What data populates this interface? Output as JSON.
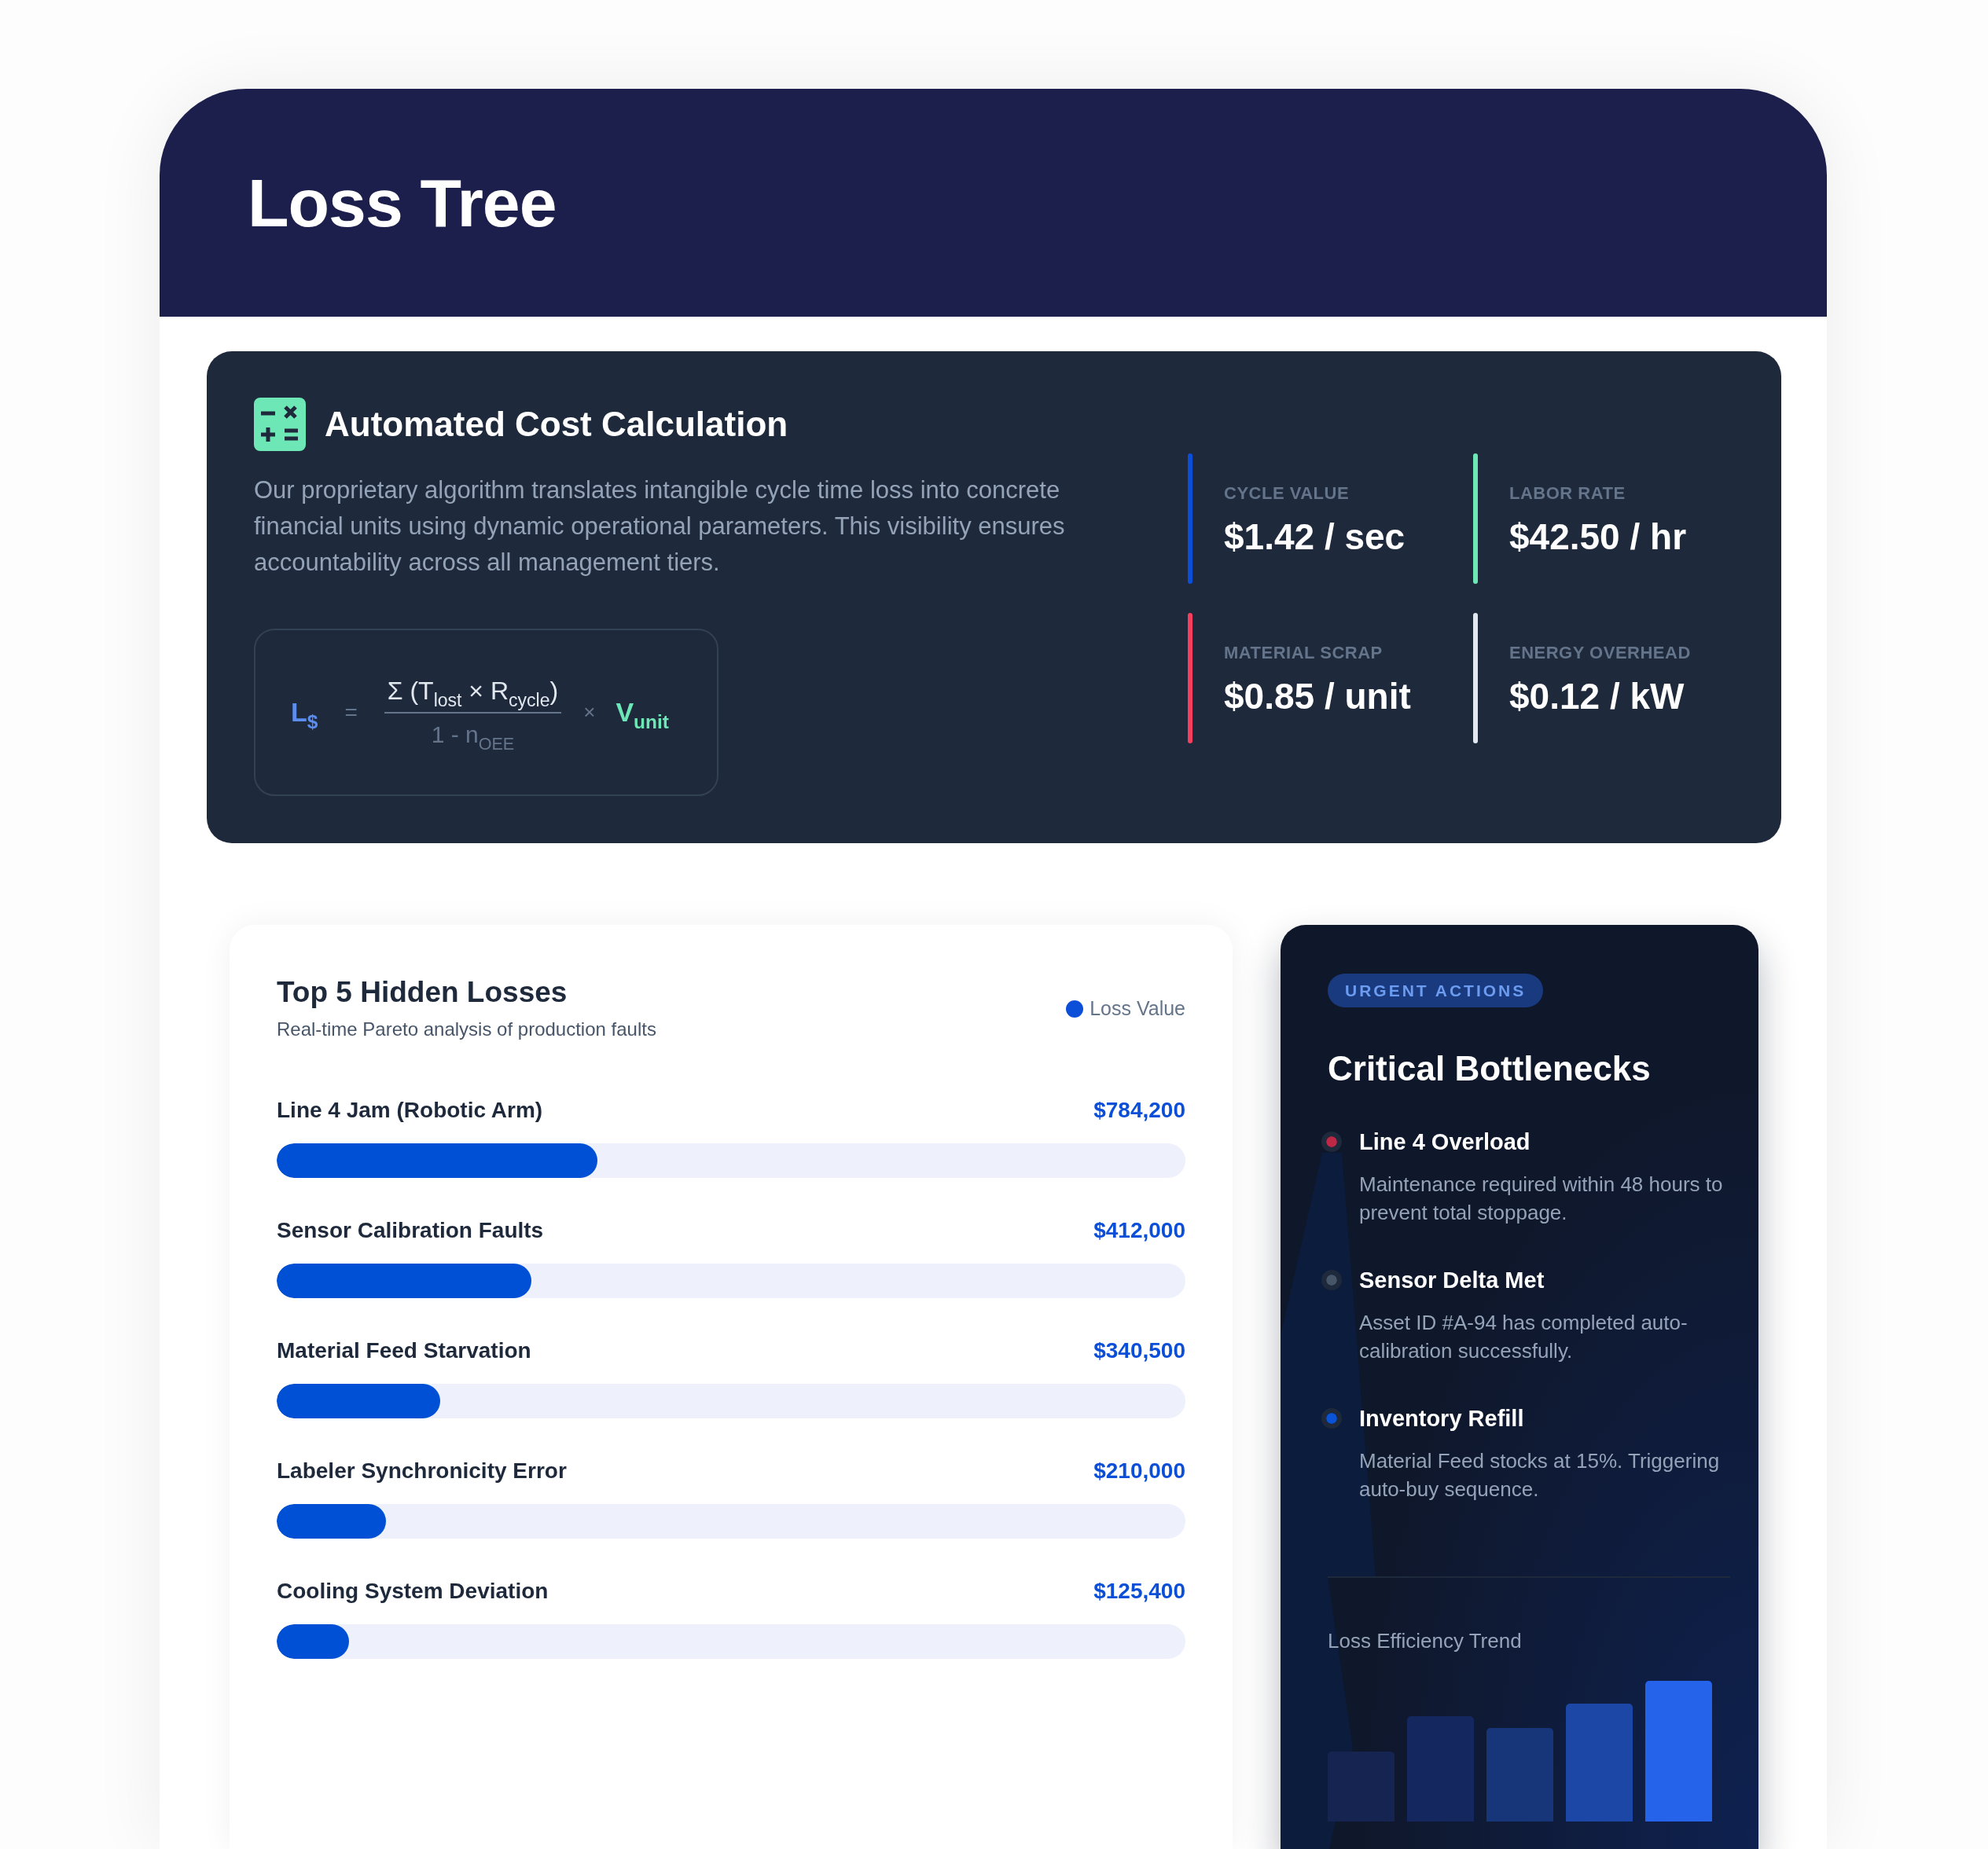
{
  "header": {
    "title": "Loss Tree"
  },
  "cost_calculation": {
    "title": "Automated Cost Calculation",
    "description": "Our proprietary algorithm translates intangible cycle time loss into concrete financial units using dynamic operational parameters. This visibility ensures accountability across all management tiers.",
    "formula": {
      "result": "L",
      "result_subscript": "$",
      "equals_sign": "=",
      "numerator": "Σ (T$_{lost}$ × R$_{cycle}$)",
      "denominator": "1 - n$_{OEE}$",
      "times_sign": "×",
      "multiplier": "V$_{unit}$"
    },
    "parameters": [
      {
        "label": "CYCLE VALUE",
        "value": "$1.42 / sec",
        "color": "#0b4fd9"
      },
      {
        "label": "LABOR RATE",
        "value": "$42.50 / hr",
        "color": "#6ee7b7"
      },
      {
        "label": "MATERIAL SCRAP",
        "value": "$0.85 / unit",
        "color": "#f43f5e"
      },
      {
        "label": "ENERGY OVERHEAD",
        "value": "$0.12 / kW",
        "color": "#e2e8f0"
      }
    ]
  },
  "hidden_losses": {
    "title": "Top 5 Hidden Losses",
    "subtitle": "Real-time Pareto analysis of production faults",
    "legend": "Loss Value",
    "rows": [
      {
        "name": "Line 4 Jam (Robotic Arm)",
        "value": "$784,200",
        "level": 0.353
      },
      {
        "name": "Sensor Calibration Faults",
        "value": "$412,000",
        "level": 0.28
      },
      {
        "name": "Material Feed Starvation",
        "value": "$340,500",
        "level": 0.18
      },
      {
        "name": "Labeler Synchronicity Error",
        "value": "$210,000",
        "level": 0.12
      },
      {
        "name": "Cooling System Deviation",
        "value": "$125,400",
        "level": 0.08
      }
    ]
  },
  "bottlenecks": {
    "tag": "URGENT ACTIONS",
    "title": "Critical Bottlenecks",
    "items": [
      {
        "title": "Line 4 Overload",
        "description": "Maintenance required within 48 hours to prevent total stoppage.",
        "color": "#be2847"
      },
      {
        "title": "Sensor Delta Met",
        "description": "Asset ID #A-94 has completed auto-calibration successfully.",
        "color": "#475569"
      },
      {
        "title": "Inventory Refill",
        "description": "Material Feed stocks at 15%. Triggering auto-buy sequence.",
        "color": "#0a52d6"
      }
    ],
    "trend": {
      "title": "Loss Efficiency Trend"
    }
  }
}
